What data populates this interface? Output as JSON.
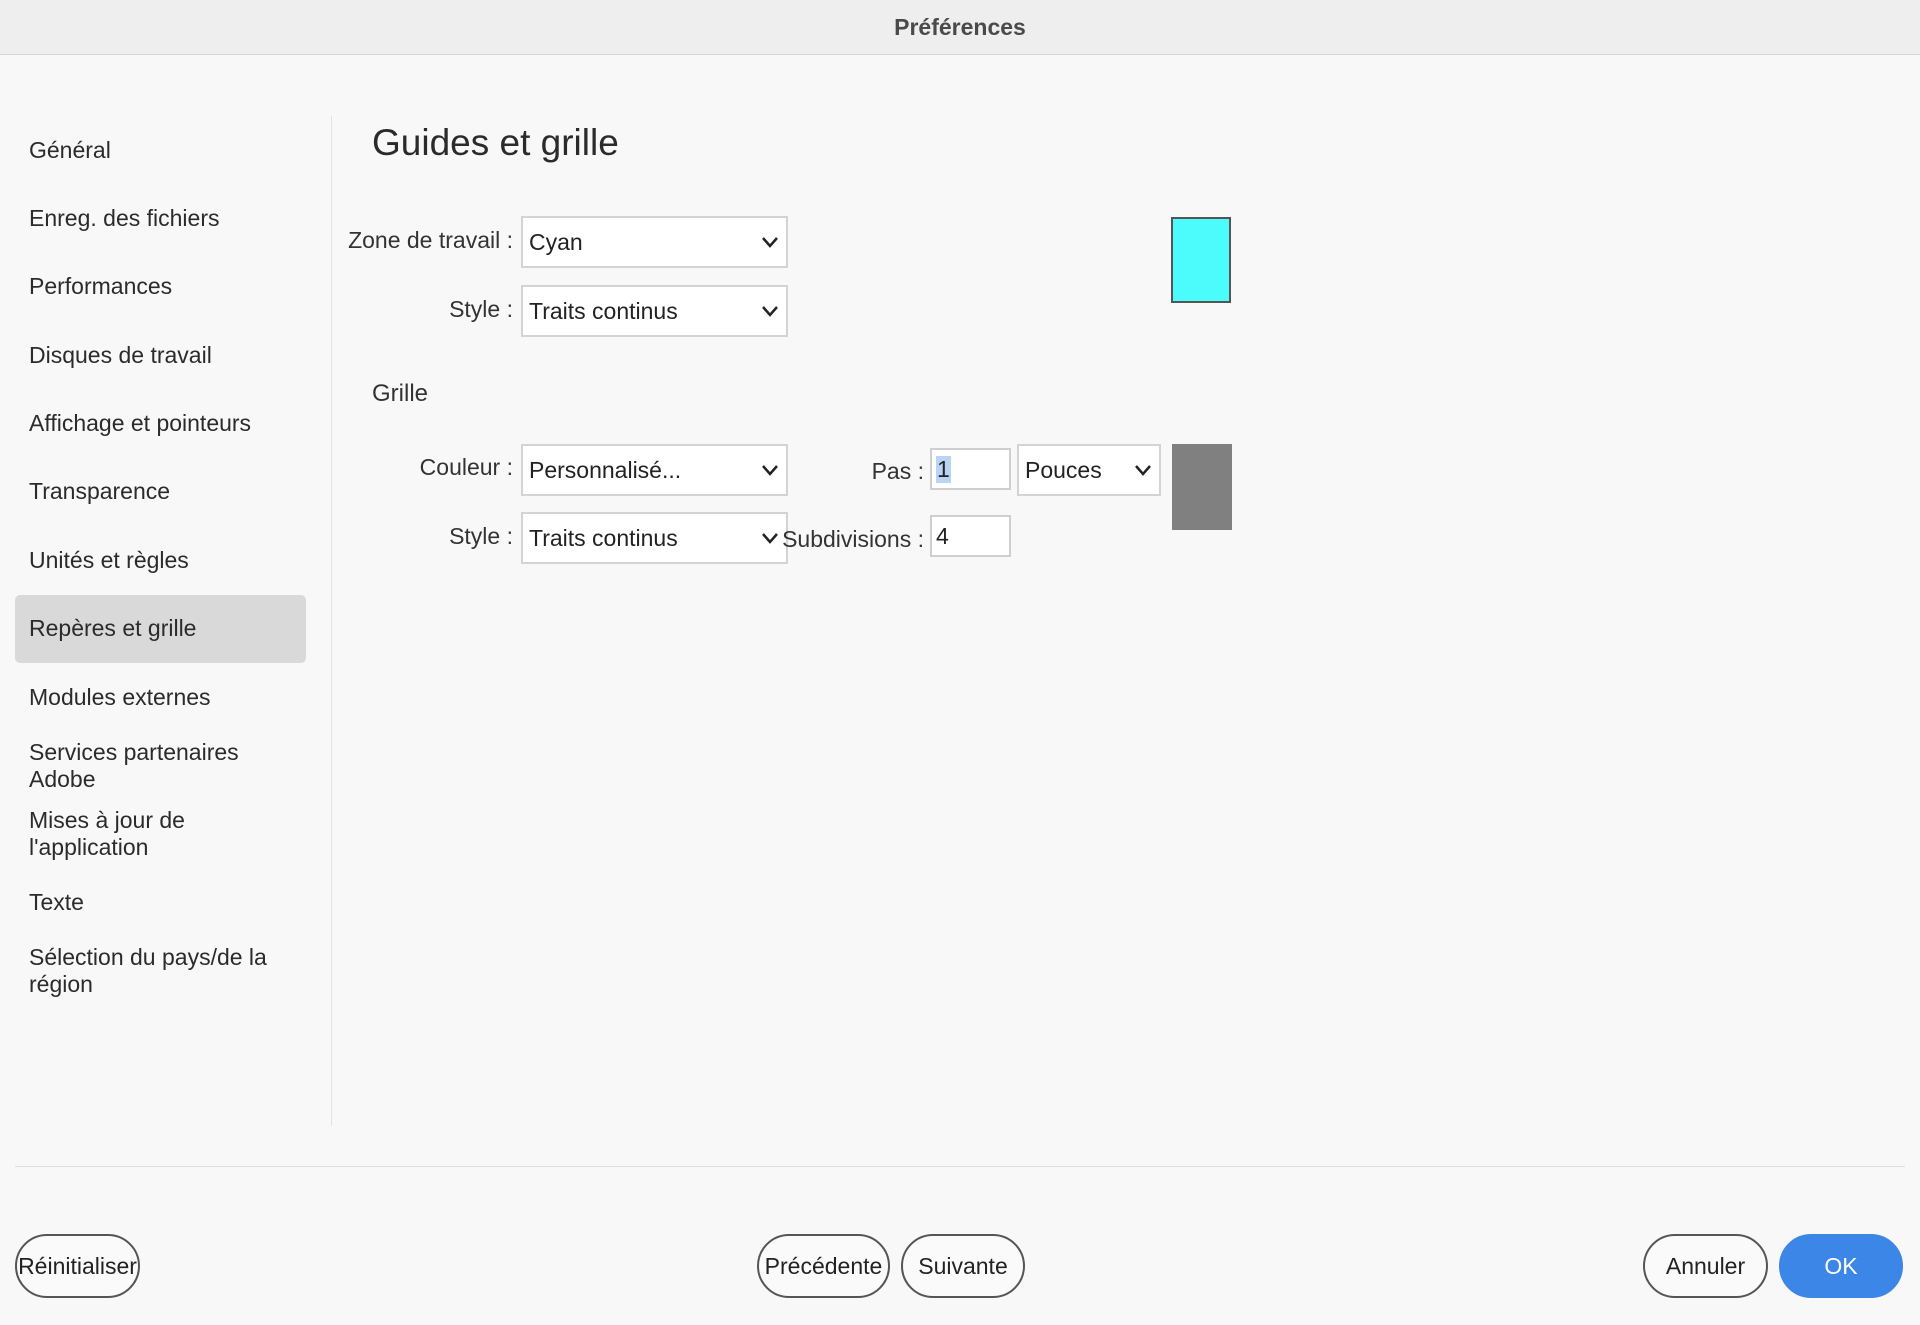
{
  "window": {
    "title": "Préférences"
  },
  "sidebar": {
    "items": [
      {
        "label": "Général"
      },
      {
        "label": "Enreg. des fichiers"
      },
      {
        "label": "Performances"
      },
      {
        "label": "Disques de travail"
      },
      {
        "label": "Affichage et pointeurs"
      },
      {
        "label": "Transparence"
      },
      {
        "label": "Unités et règles"
      },
      {
        "label": "Repères et grille",
        "active": true
      },
      {
        "label": "Modules externes"
      },
      {
        "label": "Services partenaires Adobe"
      },
      {
        "label": "Mises à jour de l'application"
      },
      {
        "label": "Texte"
      },
      {
        "label": "Sélection du pays/de la région"
      }
    ]
  },
  "main": {
    "title": "Guides et grille",
    "guides": {
      "zone_label": "Zone de travail :",
      "zone_value": "Cyan",
      "style_label": "Style :",
      "style_value": "Traits continus",
      "swatch_color": "#4cfcfc"
    },
    "grid": {
      "section_label": "Grille",
      "color_label": "Couleur :",
      "color_value": "Personnalisé...",
      "style_label": "Style :",
      "style_value": "Traits continus",
      "step_label": "Pas :",
      "step_value": "1",
      "unit_value": "Pouces",
      "subdivisions_label": "Subdivisions :",
      "subdivisions_value": "4",
      "swatch_color": "#808080"
    }
  },
  "footer": {
    "reset_label": "Réinitialiser",
    "prev_label": "Précédente",
    "next_label": "Suivante",
    "cancel_label": "Annuler",
    "ok_label": "OK"
  }
}
